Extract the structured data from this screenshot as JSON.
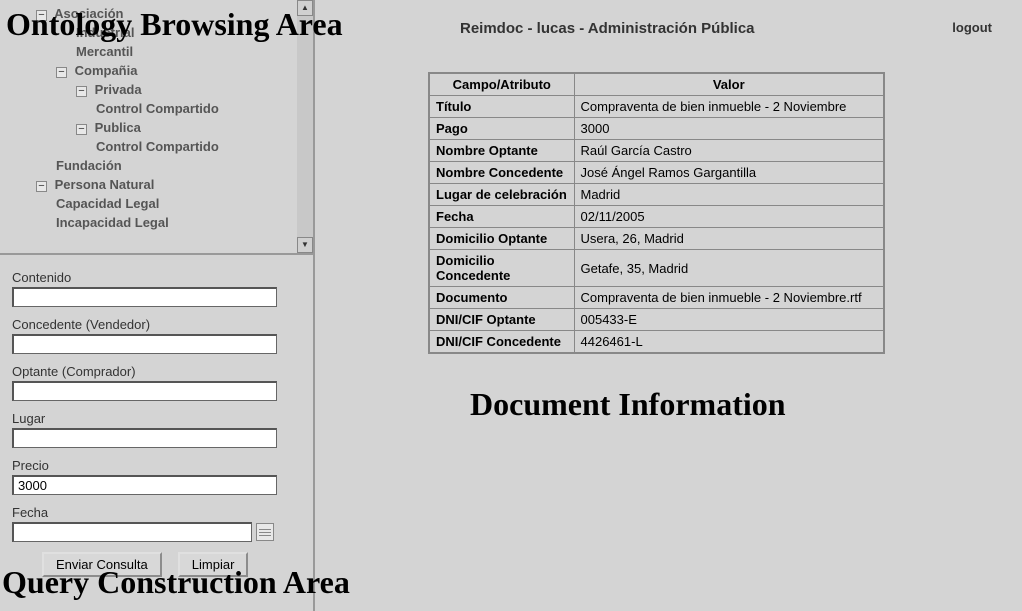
{
  "headings": {
    "browsing": "Ontology Browsing Area",
    "docinfo": "Document Information",
    "query": "Query Construction Area"
  },
  "header": {
    "breadcrumb": "Reimdoc - lucas - Administración Pública",
    "logout": "logout"
  },
  "tree": {
    "n0": {
      "toggle": "−",
      "label": "Asociación"
    },
    "n1": {
      "label": "Industrial"
    },
    "n2": {
      "label": "Mercantil"
    },
    "n3": {
      "toggle": "−",
      "label": "Compañia"
    },
    "n4": {
      "toggle": "−",
      "label": "Privada"
    },
    "n5": {
      "label": "Control Compartido"
    },
    "n6": {
      "toggle": "−",
      "label": "Publica"
    },
    "n7": {
      "label": "Control Compartido"
    },
    "n8": {
      "label": "Fundación"
    },
    "n9": {
      "toggle": "−",
      "label": "Persona Natural"
    },
    "n10": {
      "label": "Capacidad Legal"
    },
    "n11": {
      "label": "Incapacidad Legal"
    }
  },
  "form": {
    "contenido": {
      "label": "Contenido",
      "value": ""
    },
    "concedente": {
      "label": "Concedente (Vendedor)",
      "value": ""
    },
    "optante": {
      "label": "Optante (Comprador)",
      "value": ""
    },
    "lugar": {
      "label": "Lugar",
      "value": ""
    },
    "precio": {
      "label": "Precio",
      "value": "3000"
    },
    "fecha": {
      "label": "Fecha",
      "value": ""
    },
    "submit": "Enviar Consulta",
    "clear": "Limpiar"
  },
  "table": {
    "col_field": "Campo/Atributo",
    "col_value": "Valor",
    "rows": [
      {
        "field": "Título",
        "value": "Compraventa de bien inmueble - 2 Noviembre"
      },
      {
        "field": "Pago",
        "value": "3000"
      },
      {
        "field": "Nombre Optante",
        "value": "Raúl García Castro"
      },
      {
        "field": "Nombre Concedente",
        "value": "José Ángel Ramos Gargantilla"
      },
      {
        "field": "Lugar de celebración",
        "value": "Madrid"
      },
      {
        "field": "Fecha",
        "value": "02/11/2005"
      },
      {
        "field": "Domicilio Optante",
        "value": "Usera, 26, Madrid"
      },
      {
        "field": "Domicilio Concedente",
        "value": "Getafe, 35, Madrid"
      },
      {
        "field": "Documento",
        "value": "Compraventa de bien inmueble - 2 Noviembre.rtf"
      },
      {
        "field": "DNI/CIF Optante",
        "value": "005433-E"
      },
      {
        "field": "DNI/CIF Concedente",
        "value": "4426461-L"
      }
    ]
  }
}
